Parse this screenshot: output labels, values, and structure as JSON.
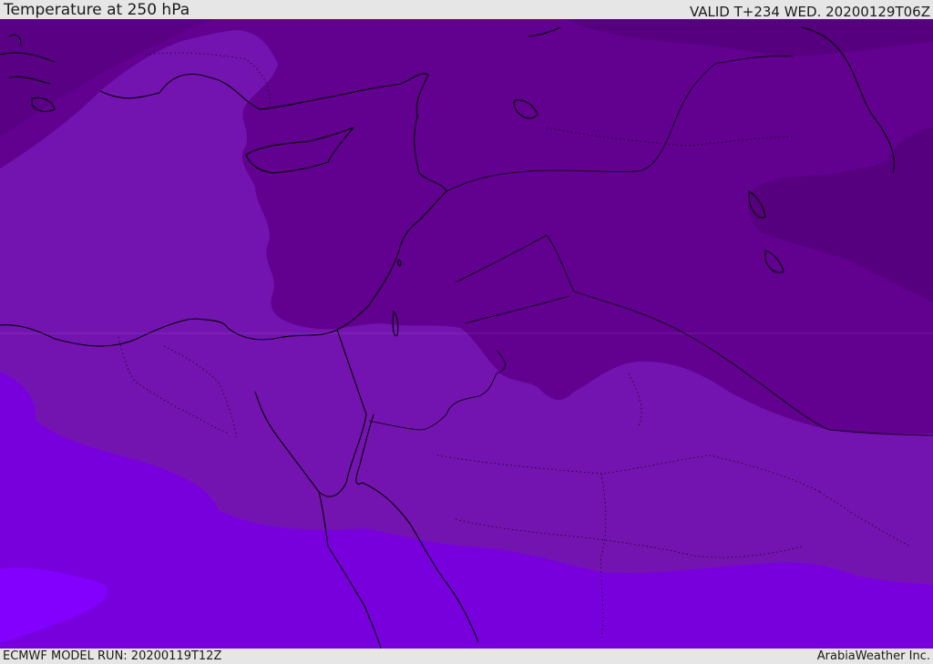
{
  "header": {
    "title": "Temperature at 250 hPa",
    "valid": "VALID T+234 WED. 20200129T06Z"
  },
  "footer": {
    "model_run": "ECMWF MODEL RUN: 20200119T12Z",
    "credit": "ArabiaWeather Inc."
  },
  "map": {
    "field": "Temperature",
    "level": "250 hPa",
    "region": "Eastern Mediterranean / Middle East",
    "colors": {
      "coldest": "#57007f",
      "cold": "#62008f",
      "mid": "#7414b0",
      "warm": "#7800dc",
      "warmest": "#8300ff",
      "coastline": "#000000"
    }
  }
}
